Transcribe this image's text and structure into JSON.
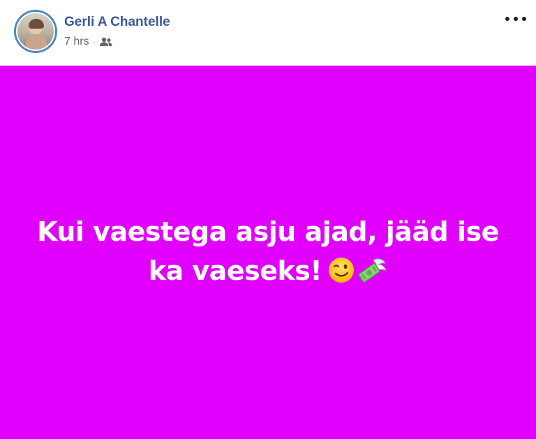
{
  "post": {
    "author": "Gerli A Chantelle",
    "time": "7 hrs",
    "separator": "·",
    "audience_icon": "friends-icon",
    "menu_icon": "more-options-icon",
    "background_color": "#e100fe",
    "text_line1": "Kui vaestega asju ajad, jääd ise",
    "text_line2": "ka vaeseks!",
    "emojis": [
      "winking-face-emoji",
      "money-with-wings-emoji"
    ]
  }
}
